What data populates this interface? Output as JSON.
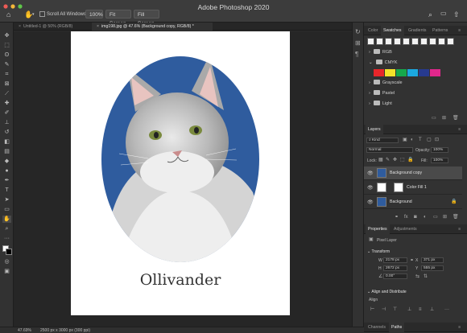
{
  "app": {
    "title": "Adobe Photoshop 2020"
  },
  "options_bar": {
    "scroll_all_windows": "Scroll All Windows",
    "zoom_value": "100%",
    "fit_screen": "Fit Screen",
    "fill_screen": "Fill Screen"
  },
  "doc_tabs": [
    {
      "label": "Untitled-1 @ 50% (RGB/8)"
    },
    {
      "label": "img198.jpg @ 47.6% (Background copy, RGB/8) *"
    }
  ],
  "canvas": {
    "caption": "Ollivander",
    "oval_color": "#2f5c9e"
  },
  "status": {
    "zoom": "47.69%",
    "doc_info": "2500 px x 3000 px (300 ppi)"
  },
  "swatches_panel": {
    "tabs": [
      "Color",
      "Swatches",
      "Gradients",
      "Patterns"
    ],
    "active_tab": "Swatches",
    "groups": [
      "RGB",
      "CMYK",
      "Grayscale",
      "Pastel",
      "Light"
    ],
    "cmyk_colors": [
      "#e8262a",
      "#f3e22a",
      "#16a84c",
      "#1ba8e0",
      "#273a8f",
      "#e0278c"
    ]
  },
  "layers_panel": {
    "tab": "Layers",
    "kind": "Kind",
    "blend_mode": "Normal",
    "opacity_label": "Opacity:",
    "opacity_value": "100%",
    "lock_label": "Lock:",
    "fill_label": "Fill:",
    "fill_value": "100%",
    "layers": [
      {
        "name": "Background copy",
        "selected": true
      },
      {
        "name": "Color Fill 1",
        "selected": false
      },
      {
        "name": "Background",
        "selected": false
      }
    ]
  },
  "properties_panel": {
    "tabs": [
      "Properties",
      "Adjustments"
    ],
    "active_tab": "Properties",
    "type": "Pixel Layer",
    "transform_label": "Transform",
    "w_label": "W",
    "w_value": "2178 px",
    "h_label": "H",
    "h_value": "2672 px",
    "x_label": "X",
    "x_value": "371 px",
    "y_label": "Y",
    "y_value": "555 px",
    "angle_value": "0.00°",
    "align_section": "Align and Distribute",
    "align_label": "Align"
  },
  "bottom_panel": {
    "tabs": [
      "Channels",
      "Paths"
    ],
    "active_tab": "Paths"
  }
}
